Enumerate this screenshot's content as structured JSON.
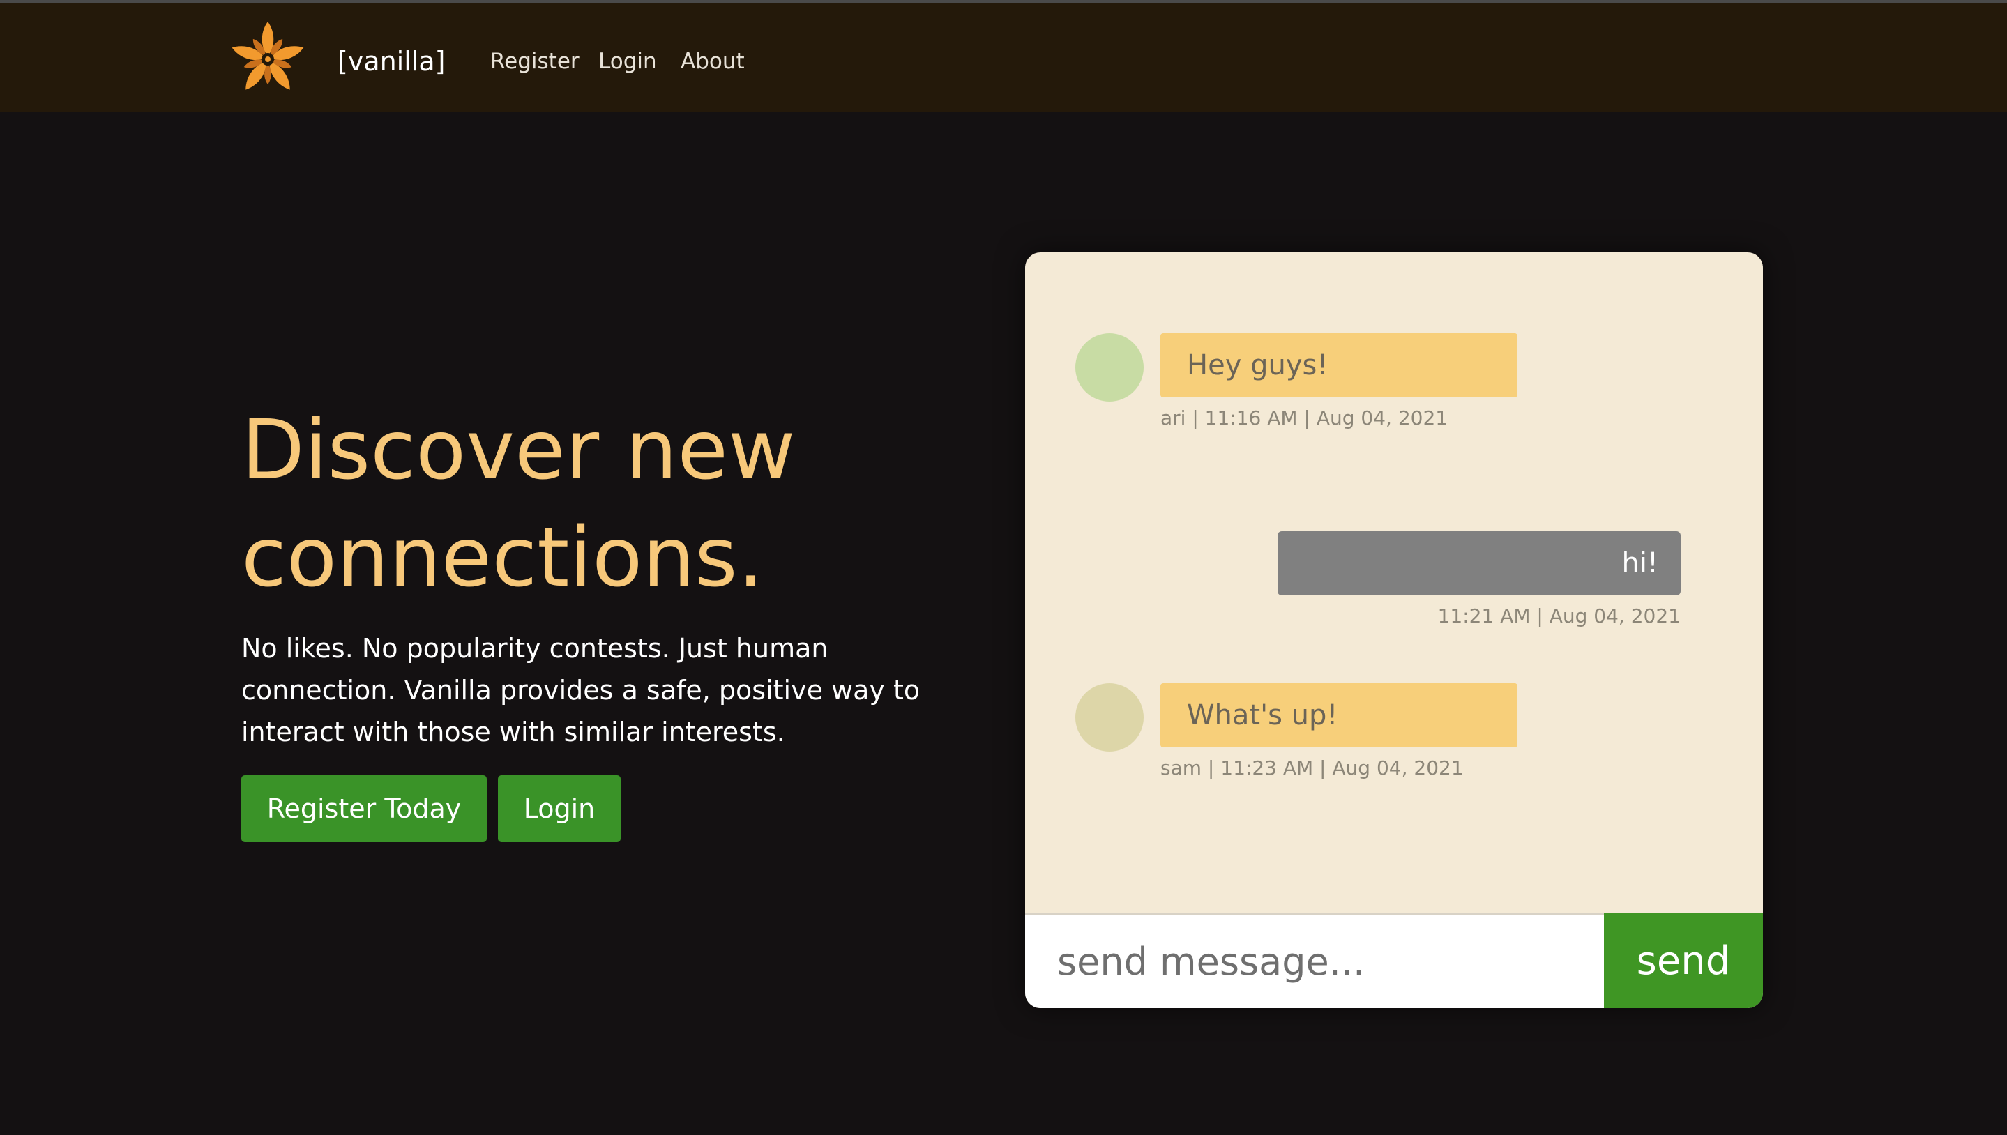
{
  "navbar": {
    "brand": "[vanilla]",
    "links": [
      {
        "label": "Register"
      },
      {
        "label": "Login"
      },
      {
        "label": "About"
      }
    ]
  },
  "hero": {
    "title": "Discover new connections.",
    "subtitle": "No likes. No popularity contests. Just human connection. Vanilla provides a safe, positive way to interact with those with similar interests.",
    "primary_button": "Register Today",
    "secondary_button": "Login"
  },
  "chat": {
    "messages": [
      {
        "text": "Hey guys!",
        "meta": "ari | 11:16 AM | Aug 04, 2021",
        "direction": "incoming",
        "avatar_color": "#c8dca4"
      },
      {
        "text": "hi!",
        "meta": "11:21 AM | Aug 04, 2021",
        "direction": "outgoing"
      },
      {
        "text": "What's up!",
        "meta": "sam | 11:23 AM | Aug 04, 2021",
        "direction": "incoming",
        "avatar_color": "#ddd6a8"
      }
    ],
    "input_placeholder": "send message...",
    "send_label": "send"
  },
  "colors": {
    "background": "#141112",
    "navbar": "#24190a",
    "accent": "#f7c87a",
    "button_green": "#3a9328",
    "card": "#f4ead6",
    "logo_orange": "#f29a2e"
  },
  "icons": {
    "logo": "flower-logo-icon"
  }
}
